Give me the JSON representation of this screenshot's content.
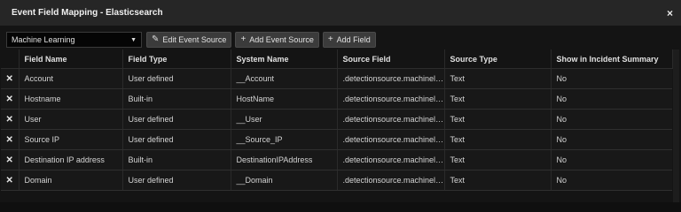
{
  "window": {
    "title": "Event Field Mapping - Elasticsearch",
    "close_glyph": "×"
  },
  "toolbar": {
    "select_value": "Machine Learning",
    "edit_label": "Edit Event Source",
    "add_source_label": "Add Event Source",
    "add_field_label": "Add Field"
  },
  "table": {
    "columns": [
      "Field Name",
      "Field Type",
      "System Name",
      "Source Field",
      "Source Type",
      "Show in Incident Summary"
    ],
    "rows": [
      [
        "Account",
        "User defined",
        "__Account",
        ".detectionsource.machinele...",
        "Text",
        "No"
      ],
      [
        "Hostname",
        "Built-in",
        "HostName",
        ".detectionsource.machinele...",
        "Text",
        "No"
      ],
      [
        "User",
        "User defined",
        "__User",
        ".detectionsource.machinele...",
        "Text",
        "No"
      ],
      [
        "Source IP",
        "User defined",
        "__Source_IP",
        ".detectionsource.machinele...",
        "Text",
        "No"
      ],
      [
        "Destination IP address",
        "Built-in",
        "DestinationIPAddress",
        ".detectionsource.machinele...",
        "Text",
        "No"
      ],
      [
        "Domain",
        "User defined",
        "__Domain",
        ".detectionsource.machinele...",
        "Text",
        "No"
      ]
    ]
  },
  "icons": {
    "delete": "x-icon",
    "edit": "pencil-icon",
    "add": "plus-icon",
    "dropdown": "chevron-down-icon"
  }
}
